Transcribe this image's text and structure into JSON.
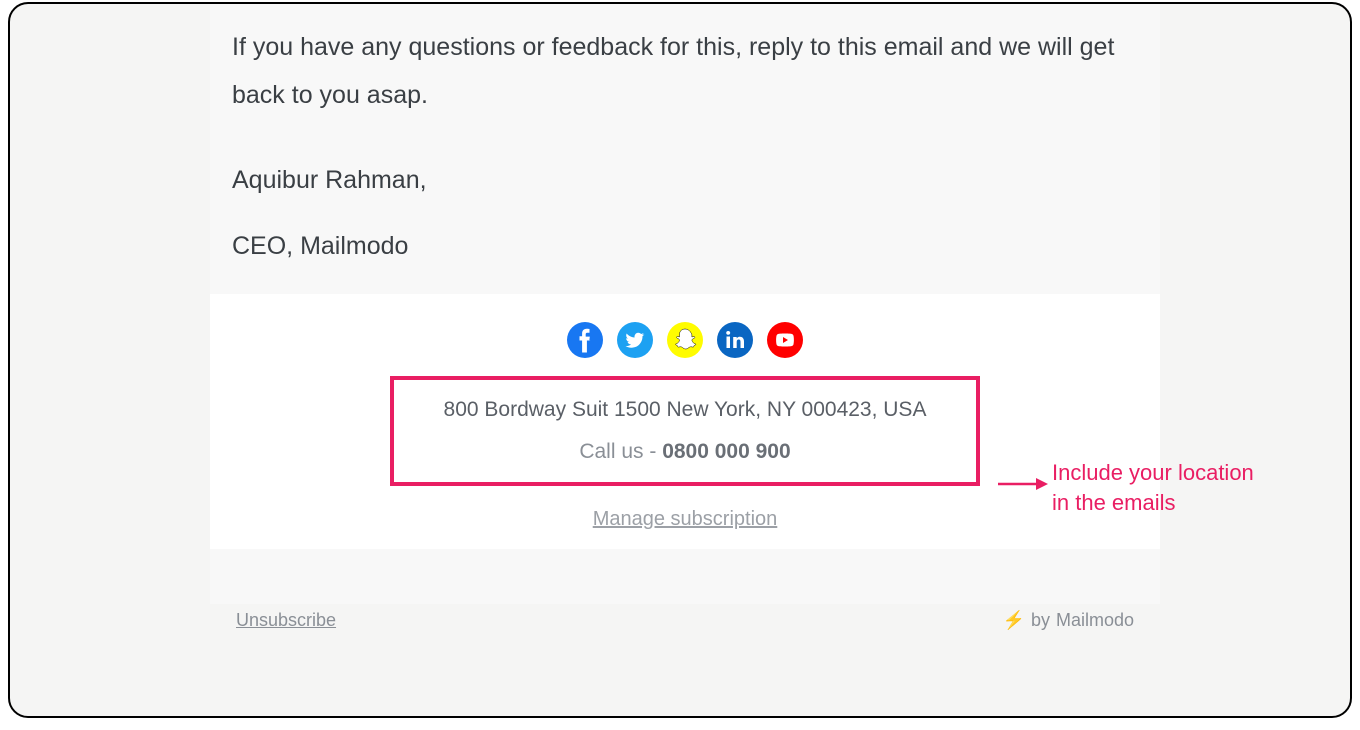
{
  "email": {
    "body_text": "If you have any questions or feedback for this, reply to this email and we will get back to you asap.",
    "signature_name": "Aquibur Rahman,",
    "signature_title": "CEO, Mailmodo"
  },
  "footer": {
    "address": "800 Bordway Suit 1500 New York, NY 000423, USA",
    "call_prefix": "Call us - ",
    "call_number": "0800 000 900",
    "manage_label": "Manage subscription"
  },
  "bottom": {
    "unsubscribe_label": "Unsubscribe",
    "by_prefix": "by ",
    "by_brand": "Mailmodo"
  },
  "annotation": {
    "line1": "Include your location",
    "line2": "in the emails"
  },
  "social": {
    "facebook": "facebook-icon",
    "twitter": "twitter-icon",
    "snapchat": "snapchat-icon",
    "linkedin": "linkedin-icon",
    "youtube": "youtube-icon"
  }
}
